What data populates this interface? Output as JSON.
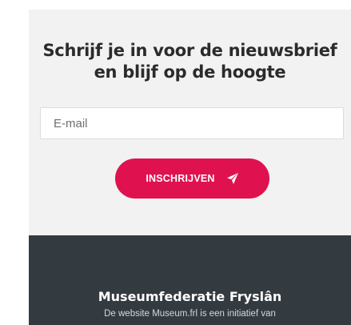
{
  "newsletter": {
    "title_line1": "Schrijf je in voor de nieuwsbrief",
    "title_line2": "en blijf op de hoogte",
    "email_placeholder": "E-mail",
    "email_value": "",
    "subscribe_label": "INSCHRIJVEN",
    "subscribe_icon": "paper-plane-icon",
    "button_color": "#e0114f",
    "background_color": "#f2f2f2"
  },
  "footer": {
    "title": "Museumfederatie Fryslân",
    "text": "De website Museum.frl is een initiatief van",
    "background_color": "#333a40"
  }
}
